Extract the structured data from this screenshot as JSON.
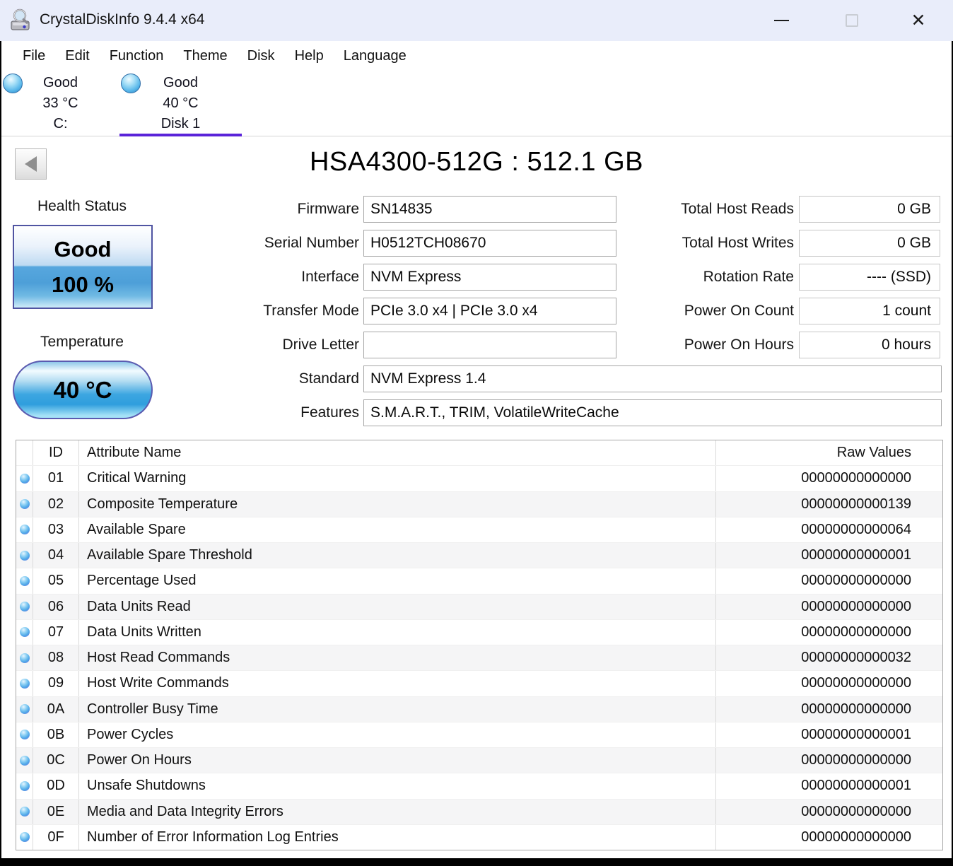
{
  "window": {
    "title": "CrystalDiskInfo 9.4.4 x64",
    "controls": {
      "close_glyph": "✕"
    }
  },
  "menu": {
    "items": [
      "File",
      "Edit",
      "Function",
      "Theme",
      "Disk",
      "Help",
      "Language"
    ]
  },
  "disk_tabs": [
    {
      "status": "Good",
      "temp": "33 °C",
      "name": "C:",
      "selected": false
    },
    {
      "status": "Good",
      "temp": "40 °C",
      "name": "Disk 1",
      "selected": true
    }
  ],
  "drive": {
    "title": "HSA4300-512G : 512.1 GB"
  },
  "health": {
    "label": "Health Status",
    "status": "Good",
    "percent": "100 %"
  },
  "temperature": {
    "label": "Temperature",
    "value": "40 °C"
  },
  "fields_left": [
    {
      "label": "Firmware",
      "value": "SN14835"
    },
    {
      "label": "Serial Number",
      "value": "H0512TCH08670"
    },
    {
      "label": "Interface",
      "value": "NVM Express"
    },
    {
      "label": "Transfer Mode",
      "value": "PCIe 3.0 x4 | PCIe 3.0 x4"
    },
    {
      "label": "Drive Letter",
      "value": ""
    }
  ],
  "fields_wide": [
    {
      "label": "Standard",
      "value": "NVM Express 1.4"
    },
    {
      "label": "Features",
      "value": "S.M.A.R.T., TRIM, VolatileWriteCache"
    }
  ],
  "fields_right": [
    {
      "label": "Total Host Reads",
      "value": "0 GB"
    },
    {
      "label": "Total Host Writes",
      "value": "0 GB"
    },
    {
      "label": "Rotation Rate",
      "value": "---- (SSD)"
    },
    {
      "label": "Power On Count",
      "value": "1 count"
    },
    {
      "label": "Power On Hours",
      "value": "0 hours"
    }
  ],
  "smart_table": {
    "headers": {
      "id": "ID",
      "name": "Attribute Name",
      "raw": "Raw Values"
    },
    "rows": [
      {
        "id": "01",
        "name": "Critical Warning",
        "raw": "00000000000000"
      },
      {
        "id": "02",
        "name": "Composite Temperature",
        "raw": "00000000000139"
      },
      {
        "id": "03",
        "name": "Available Spare",
        "raw": "00000000000064"
      },
      {
        "id": "04",
        "name": "Available Spare Threshold",
        "raw": "00000000000001"
      },
      {
        "id": "05",
        "name": "Percentage Used",
        "raw": "00000000000000"
      },
      {
        "id": "06",
        "name": "Data Units Read",
        "raw": "00000000000000"
      },
      {
        "id": "07",
        "name": "Data Units Written",
        "raw": "00000000000000"
      },
      {
        "id": "08",
        "name": "Host Read Commands",
        "raw": "00000000000032"
      },
      {
        "id": "09",
        "name": "Host Write Commands",
        "raw": "00000000000000"
      },
      {
        "id": "0A",
        "name": "Controller Busy Time",
        "raw": "00000000000000"
      },
      {
        "id": "0B",
        "name": "Power Cycles",
        "raw": "00000000000001"
      },
      {
        "id": "0C",
        "name": "Power On Hours",
        "raw": "00000000000000"
      },
      {
        "id": "0D",
        "name": "Unsafe Shutdowns",
        "raw": "00000000000001"
      },
      {
        "id": "0E",
        "name": "Media and Data Integrity Errors",
        "raw": "00000000000000"
      },
      {
        "id": "0F",
        "name": "Number of Error Information Log Entries",
        "raw": "00000000000000"
      }
    ]
  },
  "colors": {
    "tab_underline": "#5a23d9",
    "titlebar_bg": "#e9edfa",
    "health_blue": "#57a7de",
    "shaded_row": "#f5f5f6"
  }
}
